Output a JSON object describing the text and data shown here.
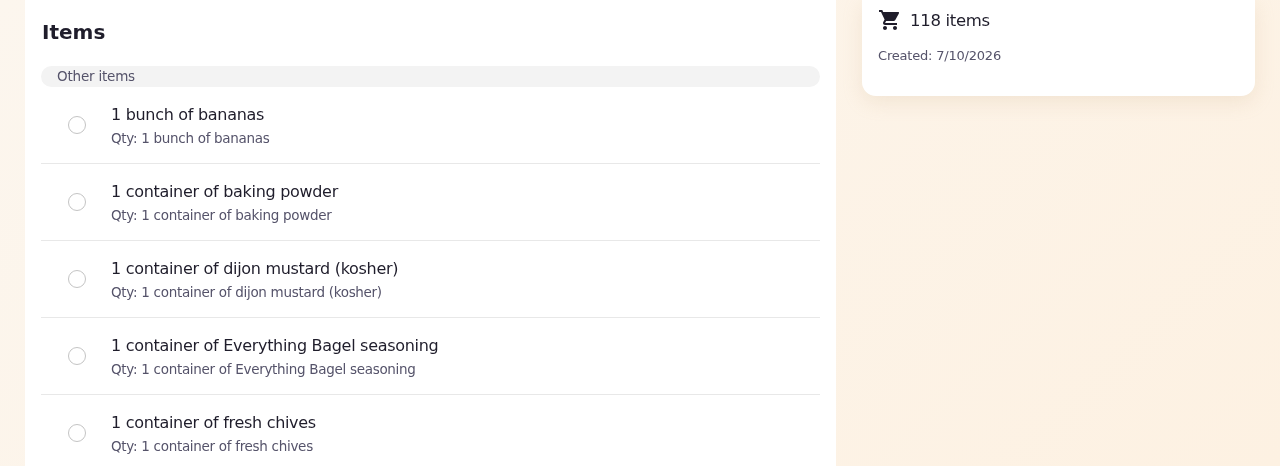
{
  "items_panel": {
    "title": "Items",
    "groups": [
      {
        "label": "Other items",
        "items": [
          {
            "name": "1 bunch of bananas",
            "quantity": "Qty: 1 bunch of bananas",
            "checked": false
          },
          {
            "name": "1 container of baking powder",
            "quantity": "Qty: 1 container of baking powder",
            "checked": false
          },
          {
            "name": "1 container of dijon mustard (kosher)",
            "quantity": "Qty: 1 container of dijon mustard (kosher)",
            "checked": false
          },
          {
            "name": "1 container of Everything Bagel seasoning",
            "quantity": "Qty: 1 container of Everything Bagel seasoning",
            "checked": false
          },
          {
            "name": "1 container of fresh chives",
            "quantity": "Qty: 1 container of fresh chives",
            "checked": false
          }
        ]
      }
    ]
  },
  "summary_card": {
    "item_count": "118 items",
    "created": "Created: 7/10/2026"
  }
}
